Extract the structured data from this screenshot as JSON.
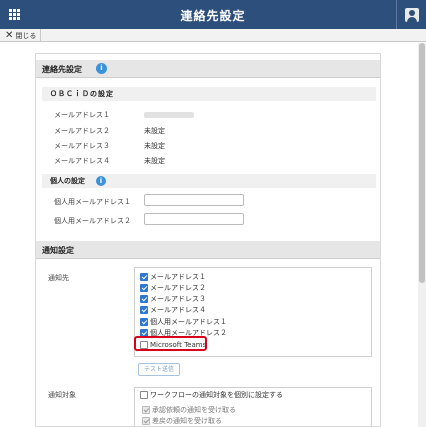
{
  "header": {
    "title": "連絡先設定",
    "close_label": "閉じる",
    "close_icon": "✕",
    "bar_color": "#2d4f7c"
  },
  "contact": {
    "section_title": "連絡先設定",
    "obcid_title": "ＯＢＣｉＤの設定",
    "emails": [
      {
        "label": "メールアドレス１",
        "value": ""
      },
      {
        "label": "メールアドレス２",
        "value": "未設定"
      },
      {
        "label": "メールアドレス３",
        "value": "未設定"
      },
      {
        "label": "メールアドレス４",
        "value": "未設定"
      }
    ],
    "personal_title": "個人の設定",
    "personal_fields": [
      {
        "label": "個人用メールアドレス１",
        "value": ""
      },
      {
        "label": "個人用メールアドレス２",
        "value": ""
      }
    ]
  },
  "notify": {
    "section_title": "通知設定",
    "destination_label": "通知先",
    "destinations": [
      {
        "label": "メールアドレス１",
        "checked": true
      },
      {
        "label": "メールアドレス２",
        "checked": true
      },
      {
        "label": "メールアドレス３",
        "checked": true
      },
      {
        "label": "メールアドレス４",
        "checked": true
      },
      {
        "label": "個人用メールアドレス１",
        "checked": true
      },
      {
        "label": "個人用メールアドレス２",
        "checked": true
      },
      {
        "label": "Microsoft Teams",
        "checked": false
      }
    ],
    "test_button": "テスト送信",
    "target_label": "通知対象",
    "individual_option": "ワークフローの通知対象を個別に設定する",
    "targets": [
      {
        "label": "承認依頼の通知を受け取る",
        "checked": true
      },
      {
        "label": "差戻の通知を受け取る",
        "checked": true
      }
    ],
    "checkbox_color": "#2e78d0",
    "highlight_color": "#d9001b"
  }
}
